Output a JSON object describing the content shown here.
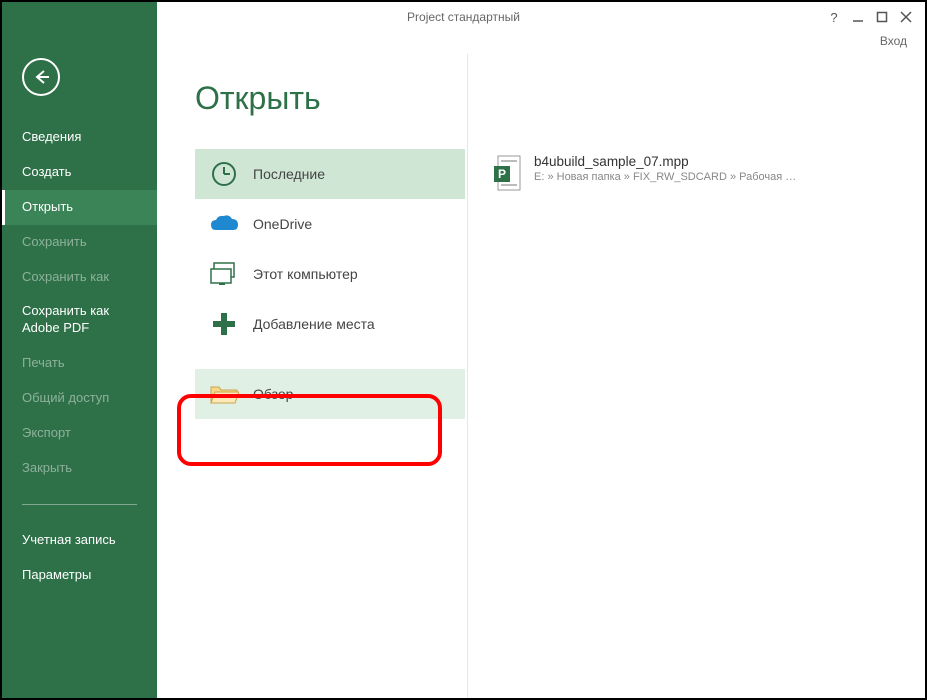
{
  "window": {
    "title": "Project стандартный",
    "login": "Вход"
  },
  "sidebar": {
    "items": [
      {
        "label": "Сведения",
        "state": "normal"
      },
      {
        "label": "Создать",
        "state": "normal"
      },
      {
        "label": "Открыть",
        "state": "selected"
      },
      {
        "label": "Сохранить",
        "state": "disabled"
      },
      {
        "label": "Сохранить как",
        "state": "disabled"
      },
      {
        "label": "Сохранить как Adobe PDF",
        "state": "normal"
      },
      {
        "label": "Печать",
        "state": "disabled"
      },
      {
        "label": "Общий доступ",
        "state": "disabled"
      },
      {
        "label": "Экспорт",
        "state": "disabled"
      },
      {
        "label": "Закрыть",
        "state": "disabled"
      }
    ],
    "footer": [
      {
        "label": "Учетная запись"
      },
      {
        "label": "Параметры"
      }
    ]
  },
  "main": {
    "title": "Открыть",
    "places": [
      {
        "icon": "clock-icon",
        "label": "Последние",
        "state": "selected"
      },
      {
        "icon": "onedrive-icon",
        "label": "OneDrive",
        "state": "normal"
      },
      {
        "icon": "computer-icon",
        "label": "Этот компьютер",
        "state": "normal"
      },
      {
        "icon": "plus-icon",
        "label": "Добавление места",
        "state": "normal"
      },
      {
        "icon": "folder-icon",
        "label": "Обзор",
        "state": "highlighted"
      }
    ],
    "recent": [
      {
        "name": "b4ubuild_sample_07.mpp",
        "path": "E: » Новая папка » FIX_RW_SDCARD » Рабочая …"
      }
    ]
  },
  "colors": {
    "brand": "#2e7048",
    "brandHover": "#3a8457",
    "selectedPlace": "#cfe6d5",
    "highlightedPlace": "#e1f0e5",
    "highlightBorder": "#ff0000"
  }
}
